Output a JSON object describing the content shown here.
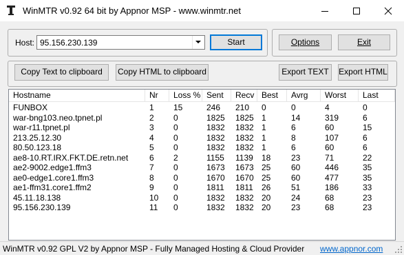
{
  "window": {
    "title": "WinMTR v0.92 64 bit by Appnor MSP - www.winmtr.net"
  },
  "host": {
    "label": "Host:",
    "value": "95.156.230.139"
  },
  "buttons": {
    "start": "Start",
    "options": "Options",
    "exit": "Exit",
    "copy_text": "Copy Text to clipboard",
    "copy_html": "Copy HTML to clipboard",
    "export_text": "Export TEXT",
    "export_html": "Export HTML"
  },
  "table": {
    "columns": [
      "Hostname",
      "Nr",
      "Loss %",
      "Sent",
      "Recv",
      "Best",
      "Avrg",
      "Worst",
      "Last"
    ],
    "rows": [
      [
        "FUNBOX",
        "1",
        "15",
        "246",
        "210",
        "0",
        "0",
        "4",
        "0"
      ],
      [
        "war-bng103.neo.tpnet.pl",
        "2",
        "0",
        "1825",
        "1825",
        "1",
        "14",
        "319",
        "6"
      ],
      [
        "war-r11.tpnet.pl",
        "3",
        "0",
        "1832",
        "1832",
        "1",
        "6",
        "60",
        "15"
      ],
      [
        "213.25.12.30",
        "4",
        "0",
        "1832",
        "1832",
        "1",
        "8",
        "107",
        "6"
      ],
      [
        "80.50.123.18",
        "5",
        "0",
        "1832",
        "1832",
        "1",
        "6",
        "60",
        "6"
      ],
      [
        "ae8-10.RT.IRX.FKT.DE.retn.net",
        "6",
        "2",
        "1155",
        "1139",
        "18",
        "23",
        "71",
        "22"
      ],
      [
        "ae2-9002.edge1.ffm3",
        "7",
        "0",
        "1673",
        "1673",
        "25",
        "60",
        "446",
        "35"
      ],
      [
        "ae0-edge1.core1.ffm3",
        "8",
        "0",
        "1670",
        "1670",
        "25",
        "60",
        "477",
        "35"
      ],
      [
        "ae1-ffm31.core1.ffm2",
        "9",
        "0",
        "1811",
        "1811",
        "26",
        "51",
        "186",
        "33"
      ],
      [
        "45.11.18.138",
        "10",
        "0",
        "1832",
        "1832",
        "20",
        "24",
        "68",
        "23"
      ],
      [
        "95.156.230.139",
        "11",
        "0",
        "1832",
        "1832",
        "20",
        "23",
        "68",
        "23"
      ]
    ]
  },
  "status": {
    "text": "WinMTR v0.92 GPL V2 by Appnor MSP - Fully Managed Hosting & Cloud Provider",
    "link": "www.appnor.com"
  },
  "colors": {
    "accent": "#0078d7",
    "link": "#0066cc"
  }
}
